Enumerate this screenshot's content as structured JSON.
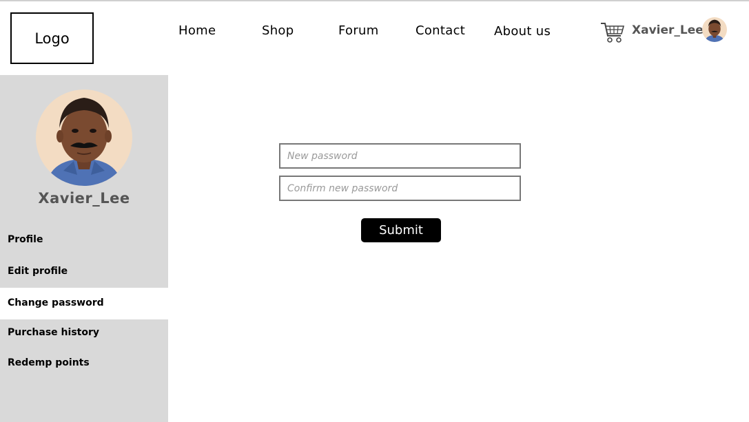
{
  "header": {
    "logo": "Logo",
    "nav": [
      "Home",
      "Shop",
      "Forum",
      "Contact",
      "About us"
    ],
    "username": "Xavier_Lee"
  },
  "sidebar": {
    "username": "Xavier_Lee",
    "items": [
      {
        "label": "Profile",
        "active": false
      },
      {
        "label": "Edit profile",
        "active": false
      },
      {
        "label": "Change password",
        "active": true
      },
      {
        "label": "Purchase history",
        "active": false
      },
      {
        "label": "Redemp points",
        "active": false
      }
    ]
  },
  "form": {
    "new_password_placeholder": "New password",
    "confirm_password_placeholder": "Confirm new password",
    "submit_label": "Submit"
  },
  "colors": {
    "sidebar_bg": "#d9d9d9",
    "active_item_bg": "#ffffff",
    "button_bg": "#000000",
    "username_text": "#555555"
  },
  "icons": [
    "shopping-cart-icon",
    "user-avatar-photo"
  ]
}
